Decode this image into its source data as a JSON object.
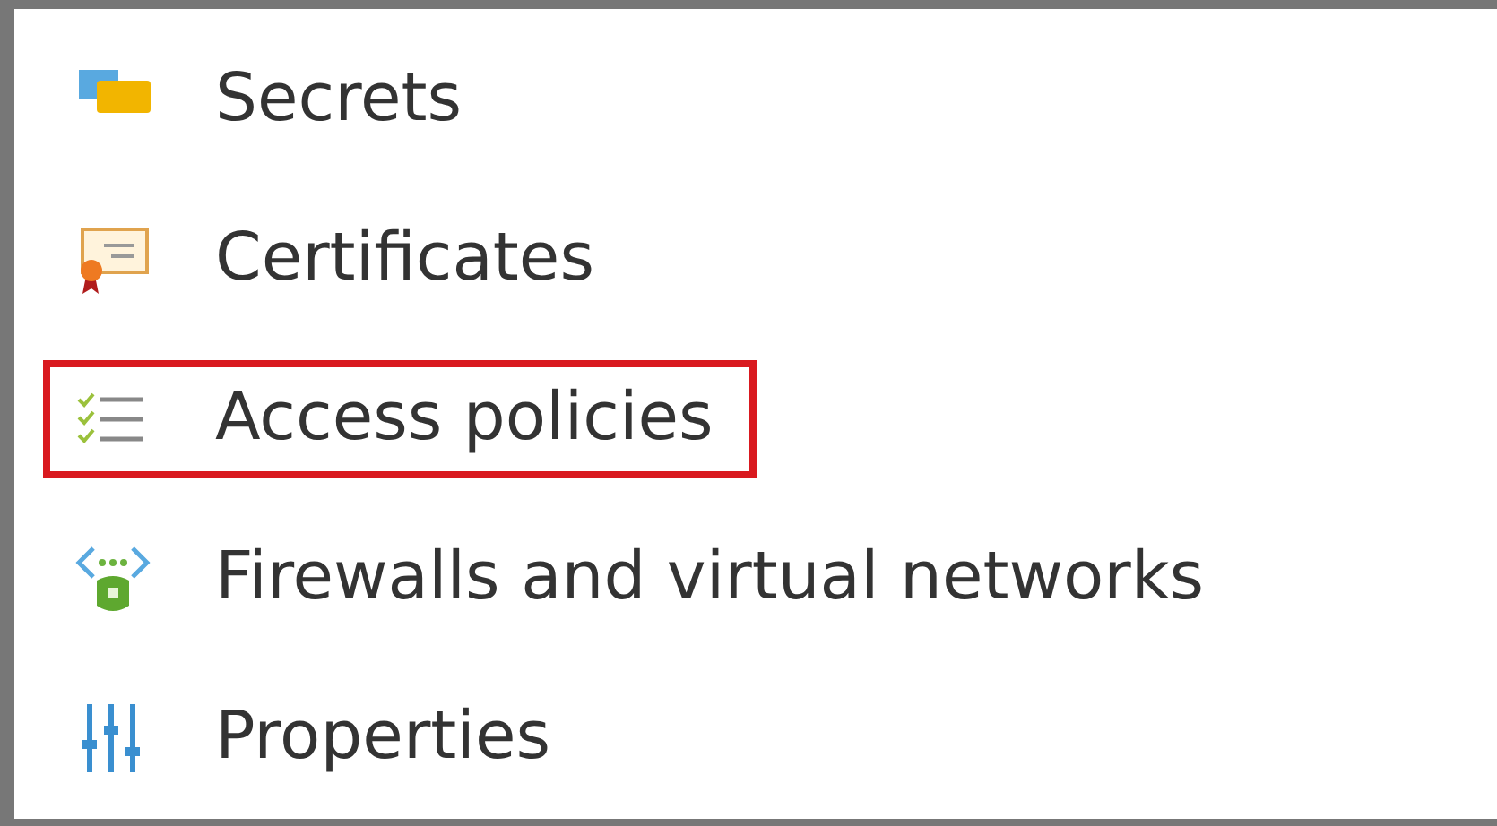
{
  "menu": {
    "items": [
      {
        "kind": "secrets",
        "label": "Secrets",
        "highlighted": false
      },
      {
        "kind": "certificates",
        "label": "Certificates",
        "highlighted": false
      },
      {
        "kind": "access",
        "label": "Access policies",
        "highlighted": true
      },
      {
        "kind": "firewall",
        "label": "Firewalls and virtual networks",
        "highlighted": false
      },
      {
        "kind": "properties",
        "label": "Properties",
        "highlighted": false
      }
    ]
  }
}
